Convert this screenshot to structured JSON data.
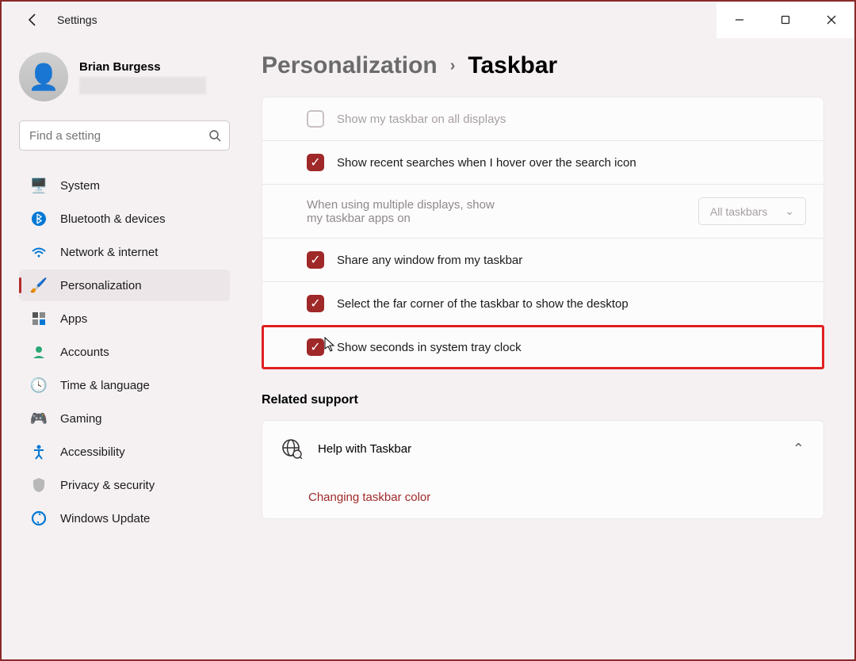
{
  "app_title": "Settings",
  "user": {
    "name": "Brian Burgess"
  },
  "search": {
    "placeholder": "Find a setting"
  },
  "nav": [
    {
      "label": "System"
    },
    {
      "label": "Bluetooth & devices"
    },
    {
      "label": "Network & internet"
    },
    {
      "label": "Personalization"
    },
    {
      "label": "Apps"
    },
    {
      "label": "Accounts"
    },
    {
      "label": "Time & language"
    },
    {
      "label": "Gaming"
    },
    {
      "label": "Accessibility"
    },
    {
      "label": "Privacy & security"
    },
    {
      "label": "Windows Update"
    }
  ],
  "breadcrumb": {
    "parent": "Personalization",
    "current": "Taskbar"
  },
  "settings": {
    "all_displays": "Show my taskbar on all displays",
    "recent_searches": "Show recent searches when I hover over the search icon",
    "multi_label": "When using multiple displays, show my taskbar apps on",
    "multi_value": "All taskbars",
    "share_window": "Share any window from my taskbar",
    "far_corner": "Select the far corner of the taskbar to show the desktop",
    "show_seconds": "Show seconds in system tray clock"
  },
  "related": {
    "title": "Related support",
    "help": "Help with Taskbar",
    "link": "Changing taskbar color"
  }
}
